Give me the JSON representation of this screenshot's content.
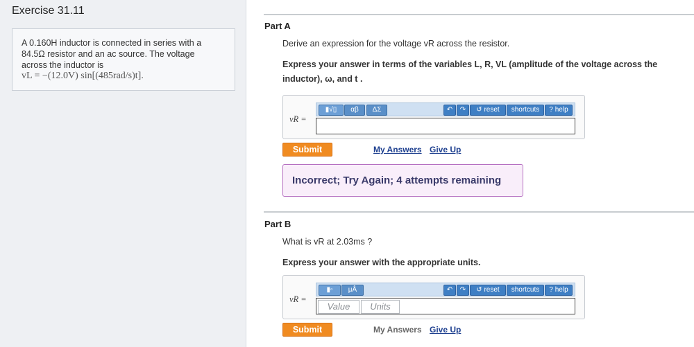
{
  "left": {
    "title": "Exercise 31.11",
    "problem_line1": "A 0.160H inductor is connected in series with a",
    "problem_line2": "84.5Ω resistor and an ac source. The voltage",
    "problem_line3": "across the inductor is",
    "problem_formula": "vL = −(12.0V) sin[(485rad/s)t]."
  },
  "partA": {
    "title": "Part A",
    "question": "Derive an expression for the voltage vR across the resistor.",
    "instruction_line1": "Express your answer in terms of the variables L, R, VL (amplitude of the voltage across the",
    "instruction_line2": "inductor), ω, and t  .",
    "input_label": "vR =",
    "toolbar": {
      "template_btn": "▮√▯",
      "greek_btn": "αβ",
      "symbols_btn": "ΔΣ",
      "reset": "reset",
      "shortcuts": "shortcuts",
      "help": "help"
    },
    "input_value": "",
    "submit": "Submit",
    "my_answers": "My Answers",
    "give_up": "Give Up",
    "feedback": "Incorrect; Try Again; 4 attempts remaining"
  },
  "partB": {
    "title": "Part B",
    "question": "What is vR at 2.03ms ?",
    "instruction": "Express your answer with the appropriate units.",
    "input_label": "vR =",
    "toolbar": {
      "template_btn": "▮▫",
      "units_btn": "μÅ",
      "reset": "reset",
      "shortcuts": "shortcuts",
      "help": "help"
    },
    "value_placeholder": "Value",
    "units_placeholder": "Units",
    "submit": "Submit",
    "my_answers": "My Answers",
    "give_up": "Give Up"
  },
  "colors": {
    "submit": "#f08b21",
    "toolbar": "#cfe0f2",
    "feedback_border": "#b56fc1",
    "link": "#1d3f8f"
  }
}
